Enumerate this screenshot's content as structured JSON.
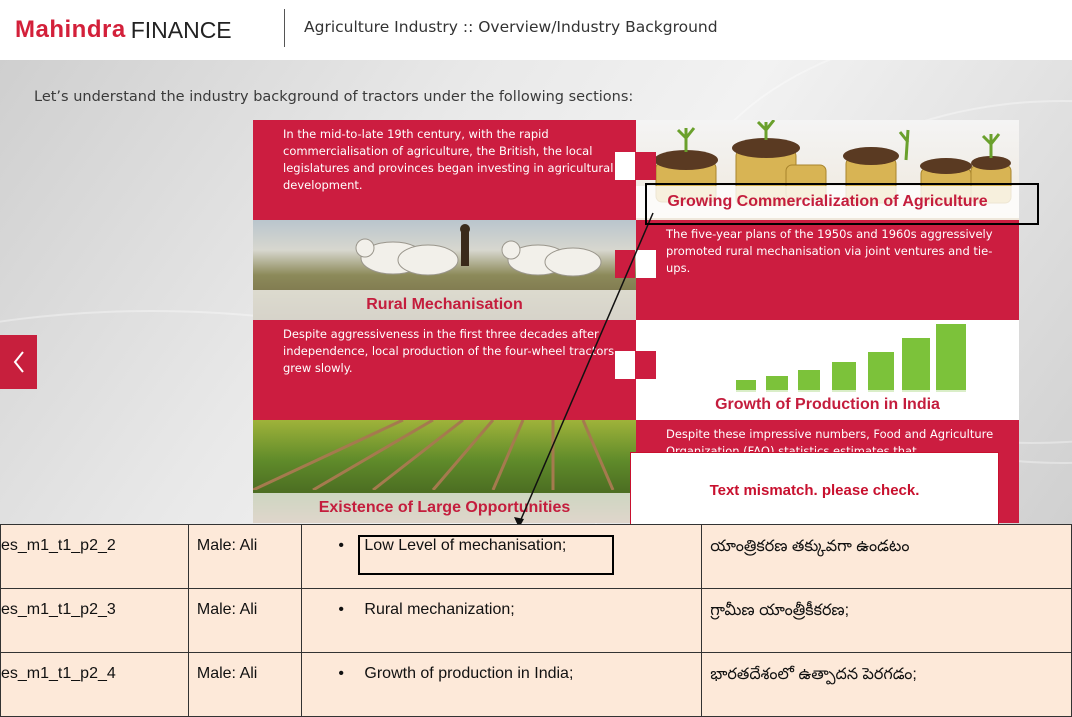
{
  "header": {
    "brand": "Mahindra",
    "brand_suffix": "FINANCE",
    "title": "Agriculture Industry :: Overview/Industry Background"
  },
  "intro": "Let’s understand the industry background of tractors under the following sections:",
  "panels": {
    "p1_text": "In the mid-to-late 19th century, with the rapid commercialisation of agriculture, the British, the local legislatures and provinces began investing in agricultural development.",
    "p2_caption": "Growing Commercialization of Agriculture",
    "p3_caption": "Rural Mechanisation",
    "p4_text": "The five-year plans of the 1950s and 1960s aggressively promoted rural mechanisation via joint ventures and tie-ups.",
    "p5_text": "Despite aggressiveness in the first three decades after independence, local production of the four-wheel tractors grew slowly.",
    "p6_caption": "Growth of Production in India",
    "p7_caption": "Existence of Large Opportunities",
    "p8_text": "Despite these impressive numbers, Food and Agriculture Organization (FAO) statistics estimates that"
  },
  "comment": "Text mismatch. please check.",
  "colors": {
    "accent": "#cc1d40",
    "comment_border": "#c8102e",
    "table_bg": "#fde9d9"
  },
  "table": {
    "rows": [
      {
        "id": "es_m1_t1_p2_2",
        "speaker": "Male: Ali",
        "english": "Low Level of mechanisation;",
        "translation": "యాంత్రికరణ తక్కువగా ఉండటం"
      },
      {
        "id": "es_m1_t1_p2_3",
        "speaker": "Male: Ali",
        "english": "Rural mechanization;",
        "translation": "గ్రామీణ యాంత్రీకీకరణ;"
      },
      {
        "id": "es_m1_t1_p2_4",
        "speaker": "Male: Ali",
        "english": "Growth of production in India;",
        "translation": "భారతదేశంలో ఉత్పాదన పెరగడం;"
      }
    ]
  }
}
